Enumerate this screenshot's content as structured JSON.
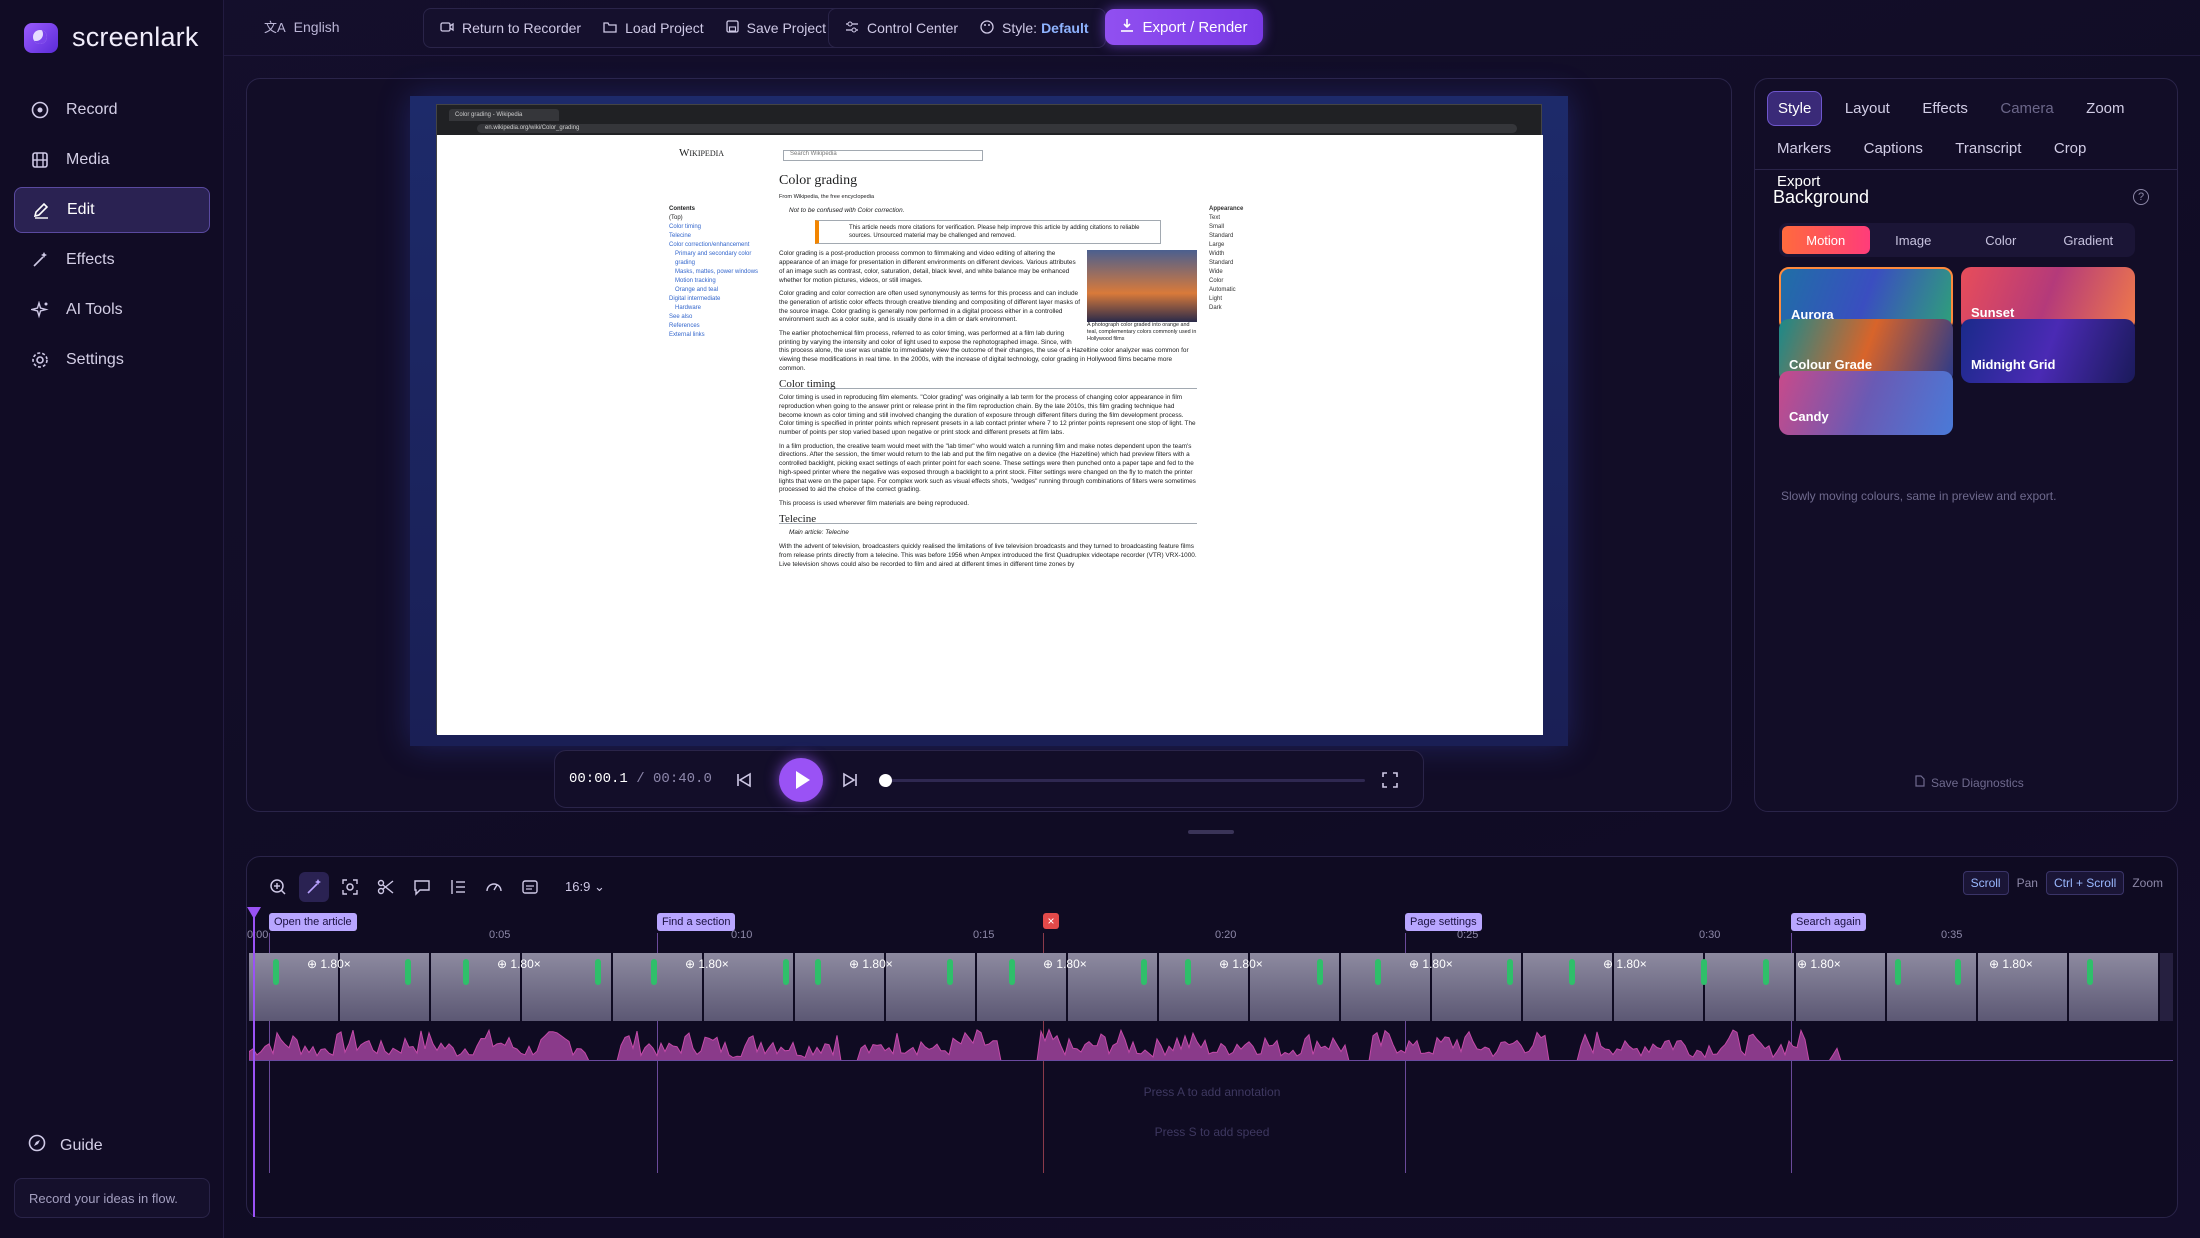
{
  "app": {
    "name": "screenlark",
    "tagline": "Record your ideas in flow."
  },
  "sidebar": {
    "items": [
      {
        "label": "Record",
        "icon": "record-icon"
      },
      {
        "label": "Media",
        "icon": "film-icon"
      },
      {
        "label": "Edit",
        "icon": "pencil-icon",
        "active": true
      },
      {
        "label": "Effects",
        "icon": "magic-wand-icon"
      },
      {
        "label": "AI Tools",
        "icon": "sparkle-icon"
      },
      {
        "label": "Settings",
        "icon": "gear-icon"
      }
    ],
    "guide": "Guide"
  },
  "topbar": {
    "language": "English",
    "return": "Return to Recorder",
    "load": "Load Project",
    "save": "Save Project",
    "control": "Control Center",
    "style_label": "Style:",
    "style_value": "Default",
    "export": "Export / Render"
  },
  "browser": {
    "tab": "Color grading - Wikipedia",
    "url": "en.wikipedia.org/wiki/Color_grading"
  },
  "wiki": {
    "logo": "Wikipedia",
    "search": "Search Wikipedia",
    "title": "Color grading",
    "from": "From Wikipedia, the free encyclopedia",
    "confused": "Not to be confused with Color correction.",
    "notice": "This article needs more citations for verification. Please help improve this article by adding citations to reliable sources. Unsourced material may be challenged and removed.",
    "p1": "Color grading is a post-production process common to filmmaking and video editing of altering the appearance of an image for presentation in different environments on different devices. Various attributes of an image such as contrast, color, saturation, detail, black level, and white balance may be enhanced whether for motion pictures, videos, or still images.",
    "p2": "Color grading and color correction are often used synonymously as terms for this process and can include the generation of artistic color effects through creative blending and compositing of different layer masks of the source image. Color grading is generally now performed in a digital process either in a controlled environment such as a color suite, and is usually done in a dim or dark environment.",
    "p3": "The earlier photochemical film process, referred to as color timing, was performed at a film lab during printing by varying the intensity and color of light used to expose the rephotographed image. Since, with this process alone, the user was unable to immediately view the outcome of their changes, the use of a Hazeltine color analyzer was common for viewing these modifications in real time. In the 2000s, with the increase of digital technology, color grading in Hollywood films became more common.",
    "h_timing": "Color timing",
    "p4": "Color timing is used in reproducing film elements. \"Color grading\" was originally a lab term for the process of changing color appearance in film reproduction when going to the answer print or release print in the film reproduction chain. By the late 2010s, this film grading technique had become known as color timing and still involved changing the duration of exposure through different filters during the film development process. Color timing is specified in printer points which represent presets in a lab contact printer where 7 to 12 printer points represent one stop of light. The number of points per stop varied based upon negative or print stock and different presets at film labs.",
    "p5": "In a film production, the creative team would meet with the \"lab timer\" who would watch a running film and make notes dependent upon the team's directions. After the session, the timer would return to the lab and put the film negative on a device (the Hazeltine) which had preview filters with a controlled backlight, picking exact settings of each printer point for each scene. These settings were then punched onto a paper tape and fed to the high-speed printer where the negative was exposed through a backlight to a print stock. Filter settings were changed on the fly to match the printer lights that were on the paper tape. For complex work such as visual effects shots, \"wedges\" running through combinations of filters were sometimes processed to aid the choice of the correct grading.",
    "p6": "This process is used wherever film materials are being reproduced.",
    "h_telecine": "Telecine",
    "main": "Main article: Telecine",
    "p7": "With the advent of television, broadcasters quickly realised the limitations of live television broadcasts and they turned to broadcasting feature films from release prints directly from a telecine. This was before 1956 when Ampex introduced the first Quadruplex videotape recorder (VTR) VRX-1000. Live television shows could also be recorded to film and aired at different times in different time zones by",
    "caption": "A photograph color graded into orange and teal, complementary colors commonly used in Hollywood films",
    "toc": [
      "Contents",
      "(Top)",
      "Color timing",
      "Telecine",
      "Color correction/enhancement",
      "Primary and secondary color grading",
      "Masks, mattes, power windows",
      "Motion tracking",
      "Orange and teal",
      "Digital intermediate",
      "Hardware",
      "See also",
      "References",
      "External links"
    ],
    "appearance": [
      "Appearance",
      "Text",
      "Small",
      "Standard",
      "Large",
      "Width",
      "Standard",
      "Wide",
      "Color",
      "Automatic",
      "Light",
      "Dark"
    ]
  },
  "player": {
    "current": "00:00.1",
    "separator": "/",
    "total": "00:40.0",
    "progress": 0.0025
  },
  "panel": {
    "tabs_row1": [
      "Style",
      "Layout",
      "Effects",
      "Camera",
      "Zoom"
    ],
    "tabs_row2": [
      "Markers",
      "Captions",
      "Transcript",
      "Crop",
      "Export"
    ],
    "section": "Background",
    "seg": [
      "Motion",
      "Image",
      "Color",
      "Gradient"
    ],
    "swatches": [
      {
        "label": "Aurora",
        "colors": [
          "#1f6fa6",
          "#3a4ec0",
          "#2fa07a"
        ]
      },
      {
        "label": "Sunset",
        "colors": [
          "#e84d5a",
          "#b43a7a",
          "#f07a4a"
        ]
      },
      {
        "label": "Colour Grade",
        "colors": [
          "#1a8a8a",
          "#d8642a",
          "#2a3a8a"
        ]
      },
      {
        "label": "Midnight Grid",
        "colors": [
          "#1a2a8a",
          "#4a2ab4",
          "#1a1a5a"
        ]
      },
      {
        "label": "Candy",
        "colors": [
          "#c84a8a",
          "#6a5ab4",
          "#4a7ad8"
        ]
      }
    ],
    "hint": "Slowly moving colours, same in preview and export.",
    "diagnostics": "Save Diagnostics"
  },
  "timeline": {
    "ratio": "16:9",
    "scroll": "Scroll",
    "pan": "Pan",
    "ctrl_scroll": "Ctrl + Scroll",
    "zoom": "Zoom",
    "ticks": [
      "0:00",
      "0:05",
      "0:10",
      "0:15",
      "0:20",
      "0:25",
      "0:30",
      "0:35"
    ],
    "markers": [
      "Open the article",
      "Find a section",
      "Page settings",
      "Search again"
    ],
    "zoom_label": "1.80×",
    "hint_annotation": "Press A to add annotation",
    "hint_speed": "Press S to add speed",
    "cut": "×"
  }
}
